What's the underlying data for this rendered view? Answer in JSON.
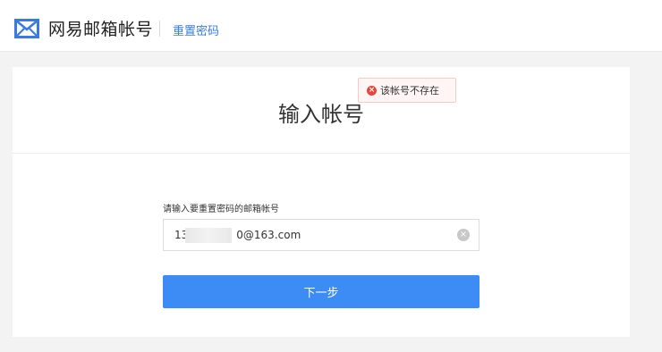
{
  "header": {
    "app_title": "网易邮箱帐号",
    "reset_link": "重置密码",
    "logo_icon": "mail-envelope-icon",
    "accent_color": "#3a7be0"
  },
  "main": {
    "title": "输入帐号",
    "error_tooltip": "该帐号不存在",
    "error_icon": "error-circle-icon",
    "error_color": "#e5463c",
    "account_field": {
      "label": "请输入要重置密码的邮箱帐号",
      "value_prefix": "13",
      "value_suffix": "0@163.com",
      "clear_icon": "clear-circle-icon"
    },
    "next_button": "下一步",
    "button_color": "#3d8cf5"
  }
}
